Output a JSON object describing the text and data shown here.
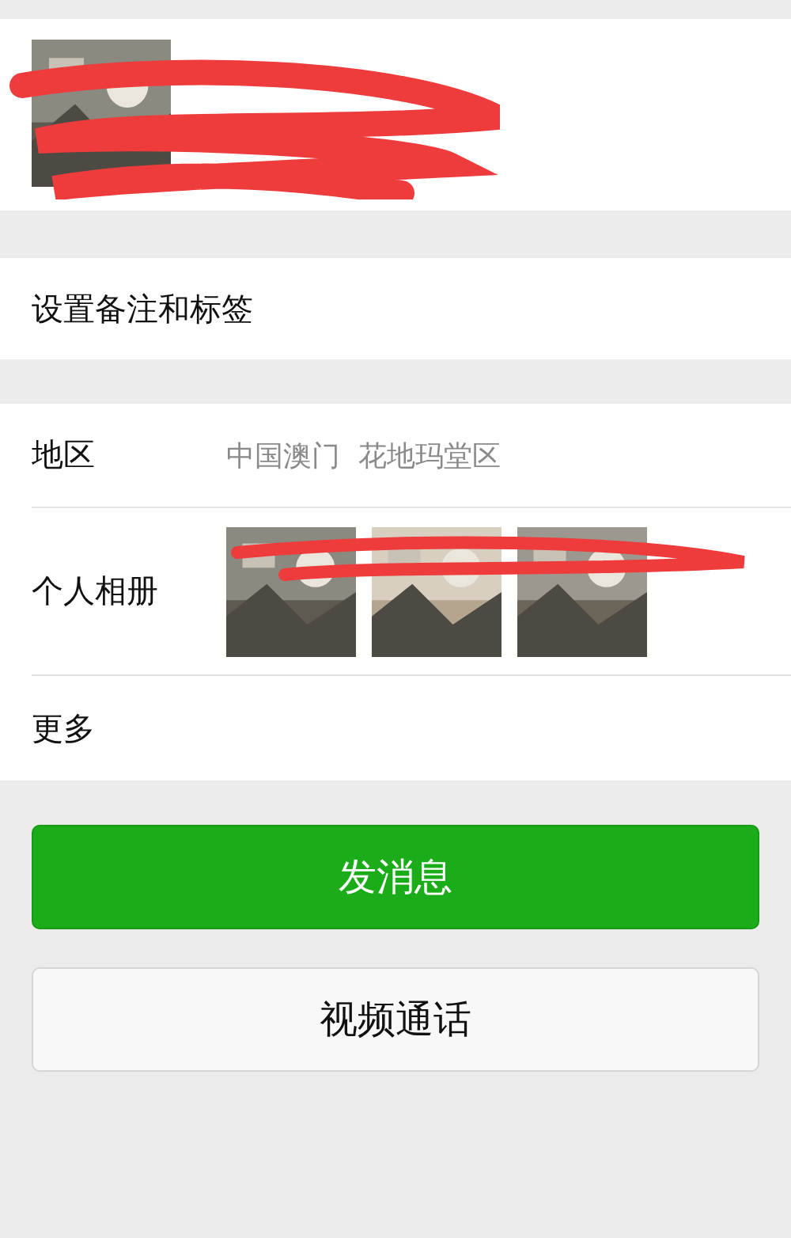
{
  "profile": {
    "redacted": true
  },
  "remark_row": {
    "label": "设置备注和标签"
  },
  "details": [
    {
      "kind": "text",
      "label": "地区",
      "value": "中国澳门  花地玛堂区"
    },
    {
      "kind": "album",
      "label": "个人相册",
      "redacted": true
    },
    {
      "kind": "plain",
      "label": "更多"
    }
  ],
  "buttons": [
    {
      "label": "发消息",
      "primary": true
    },
    {
      "label": "视频通话",
      "primary": false
    }
  ]
}
